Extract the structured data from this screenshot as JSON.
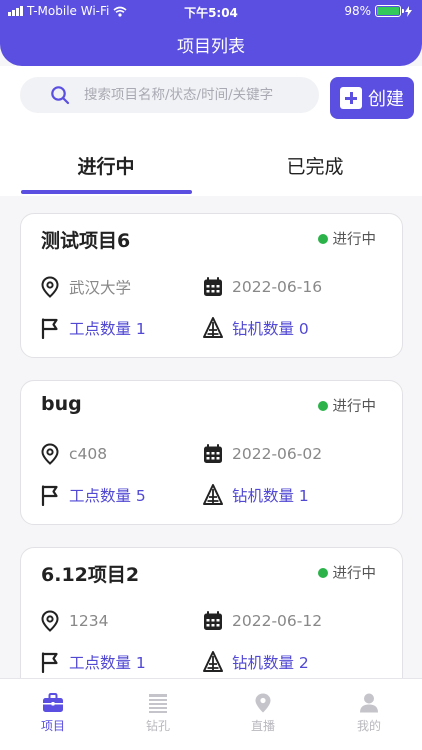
{
  "status_bar": {
    "carrier": "T-Mobile Wi-Fi",
    "time": "下午5:04",
    "battery": "98%",
    "battery_level": 0.98
  },
  "header": {
    "title": "项目列表"
  },
  "search": {
    "placeholder": "搜索项目名称/状态/时间/关键字"
  },
  "create_button": {
    "label": "创建"
  },
  "tabs": [
    {
      "label": "进行中",
      "active": true
    },
    {
      "label": "已完成",
      "active": false
    }
  ],
  "projects": [
    {
      "title": "测试项目6",
      "status": "进行中",
      "location": "武汉大学",
      "date": "2022-06-16",
      "work_points": "工点数量 1",
      "rigs": "钻机数量 0"
    },
    {
      "title": "bug",
      "status": "进行中",
      "location": "c408",
      "date": "2022-06-02",
      "work_points": "工点数量 5",
      "rigs": "钻机数量 1"
    },
    {
      "title": "6.12项目2",
      "status": "进行中",
      "location": "1234",
      "date": "2022-06-12",
      "work_points": "工点数量 1",
      "rigs": "钻机数量 2"
    }
  ],
  "tabbar": [
    {
      "label": "项目",
      "icon": "briefcase-icon",
      "active": true
    },
    {
      "label": "钻孔",
      "icon": "drill-list-icon",
      "active": false
    },
    {
      "label": "直播",
      "icon": "location-pin-icon",
      "active": false
    },
    {
      "label": "我的",
      "icon": "person-icon",
      "active": false
    }
  ],
  "colors": {
    "accent": "#5a4fe0",
    "status_dot": "#2bb34a",
    "link": "#5148d4"
  }
}
